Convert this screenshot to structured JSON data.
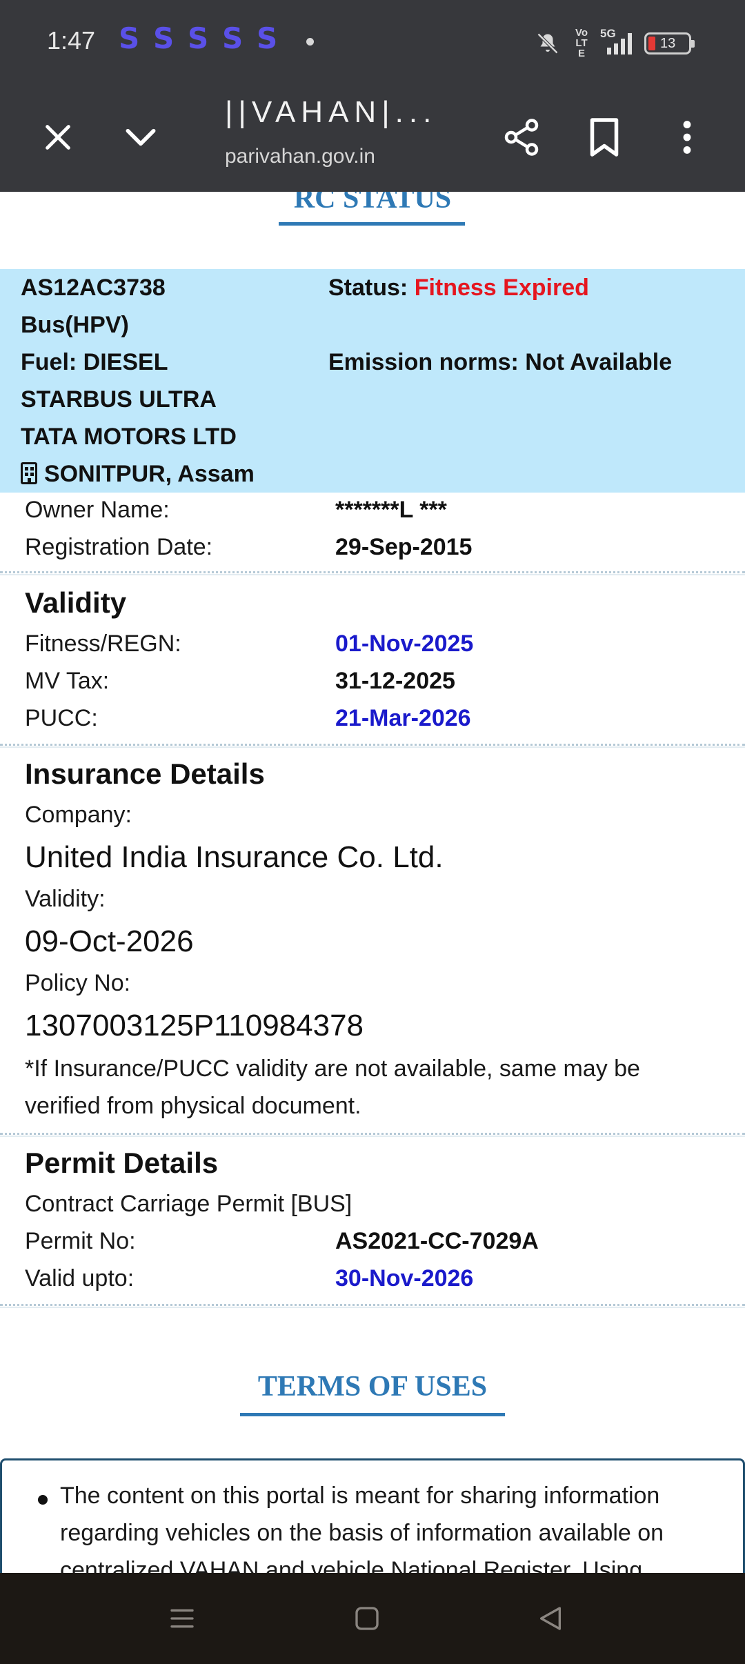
{
  "status_bar": {
    "time": "1:47",
    "notification_icon": "S",
    "notification_count": 5,
    "volte": "Vo LTE",
    "network": "5G",
    "battery_percent": "13",
    "battery_color": "#e53935"
  },
  "browser": {
    "title": "||VAHAN|...",
    "url": "parivahan.gov.in",
    "icons": [
      "close-icon",
      "chevron-down-icon",
      "share-icon",
      "bookmark-icon",
      "more-vert-icon"
    ]
  },
  "rc": {
    "section_title": "RC STATUS",
    "reg_no": "AS12AC3738",
    "vehicle_class": "Bus(HPV)",
    "fuel": "Fuel: DIESEL",
    "model": "STARBUS ULTRA",
    "maker": "TATA MOTORS LTD",
    "rto": "SONITPUR, Assam",
    "status_label": "Status:",
    "status_value": "Fitness Expired",
    "emission": "Emission norms: Not Available",
    "owner_label": "Owner Name:",
    "owner_value": "*******L ***",
    "reg_date_label": "Registration Date:",
    "reg_date_value": "29-Sep-2015"
  },
  "validity": {
    "title": "Validity",
    "fitness_label": "Fitness/REGN:",
    "fitness_value": "01-Nov-2025",
    "mvtax_label": "MV Tax:",
    "mvtax_value": "31-12-2025",
    "pucc_label": "PUCC:",
    "pucc_value": "21-Mar-2026"
  },
  "insurance": {
    "title": "Insurance Details",
    "company_label": "Company:",
    "company_value": "United India Insurance Co. Ltd.",
    "validity_label": "Validity:",
    "validity_value": "09-Oct-2026",
    "policy_label": "Policy No:",
    "policy_value": "1307003125P110984378",
    "note": "*If Insurance/PUCC validity are not available, same may be verified from physical document."
  },
  "permit": {
    "title": "Permit Details",
    "type": "Contract Carriage Permit [BUS]",
    "no_label": "Permit No:",
    "no_value": "AS2021-CC-7029A",
    "valid_label": "Valid upto:",
    "valid_value": "30-Nov-2026"
  },
  "terms": {
    "title": "TERMS OF USES",
    "text": "The content on this portal is meant for sharing information regarding vehicles on the basis of information available on centralized VAHAN and vehicle National Register. Using"
  },
  "colors": {
    "accent": "#2e79b5",
    "date_blue": "#1a1acb",
    "status_red": "#e5161f",
    "vehicle_box": "#bfe8fb"
  },
  "nav": {
    "icons": [
      "menu-icon",
      "home-icon",
      "back-icon"
    ]
  }
}
